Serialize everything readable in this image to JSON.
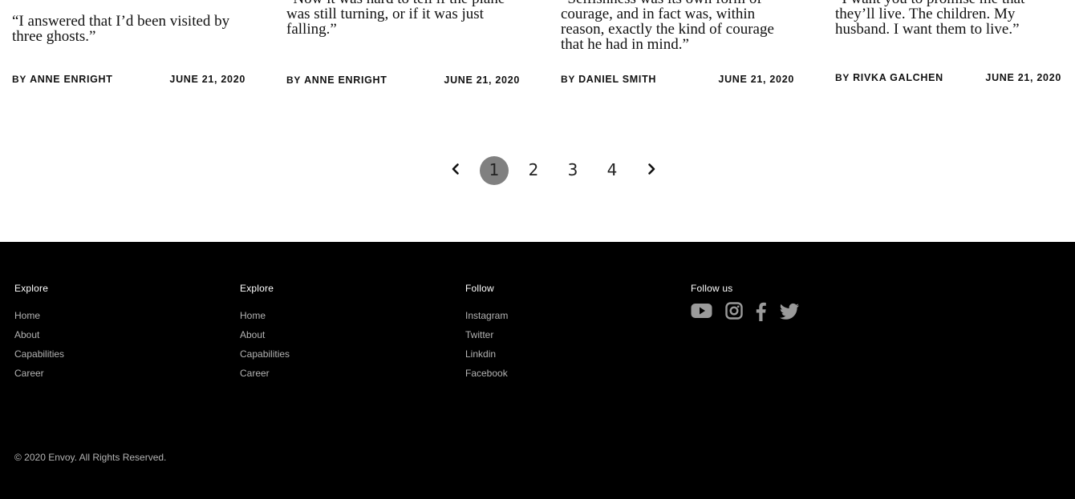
{
  "stories": [
    {
      "quote": [
        "“I answered that I’d been visited by",
        "three ghosts.”"
      ],
      "by_prefix": "BY",
      "author": "ANNE ENRIGHT",
      "date": "JUNE 21, 2020"
    },
    {
      "quote": [
        "“Now it was hard to tell if the plane",
        "was still turning, or if it was just",
        "falling.”"
      ],
      "by_prefix": "BY",
      "author": "ANNE ENRIGHT",
      "date": "JUNE 21, 2020"
    },
    {
      "quote": [
        "“Selfishness was its own form of",
        "courage, and in fact was, within",
        "reason, exactly the kind of courage",
        "that he had in mind.”"
      ],
      "by_prefix": "BY",
      "author": "DANIEL SMITH",
      "date": "JUNE 21, 2020"
    },
    {
      "quote": [
        "“I want you to promise me that",
        "they’ll live. The children. My",
        "husband. I want them to live.”"
      ],
      "by_prefix": "BY",
      "author": "RIVKA GALCHEN",
      "date": "JUNE 21, 2020"
    }
  ],
  "pagination": {
    "pages": [
      "1",
      "2",
      "3",
      "4"
    ],
    "current_page": 1,
    "prev_icon": "chevron-left-icon",
    "next_icon": "chevron-right-icon"
  },
  "footer": {
    "columns": [
      {
        "heading": "Explore",
        "links": [
          "Home",
          "About",
          "Capabilities",
          "Career"
        ]
      },
      {
        "heading": "Explore",
        "links": [
          "Home",
          "About",
          "Capabilities",
          "Career"
        ]
      },
      {
        "heading": "Follow",
        "links": [
          "Instagram",
          "Twitter",
          "Linkdin",
          "Facebook"
        ]
      }
    ],
    "follow_us": {
      "heading": "Follow us",
      "icons": [
        "youtube-icon",
        "instagram-icon",
        "facebook-icon",
        "twitter-icon"
      ]
    },
    "copyright": "© 2020 Envoy. All Rights Reserved."
  },
  "colors": {
    "footer_bg": "#000000",
    "footer_text": "#b3b3b3",
    "active_page_bg": "#808080",
    "social_icon": "#9a9a9a"
  }
}
